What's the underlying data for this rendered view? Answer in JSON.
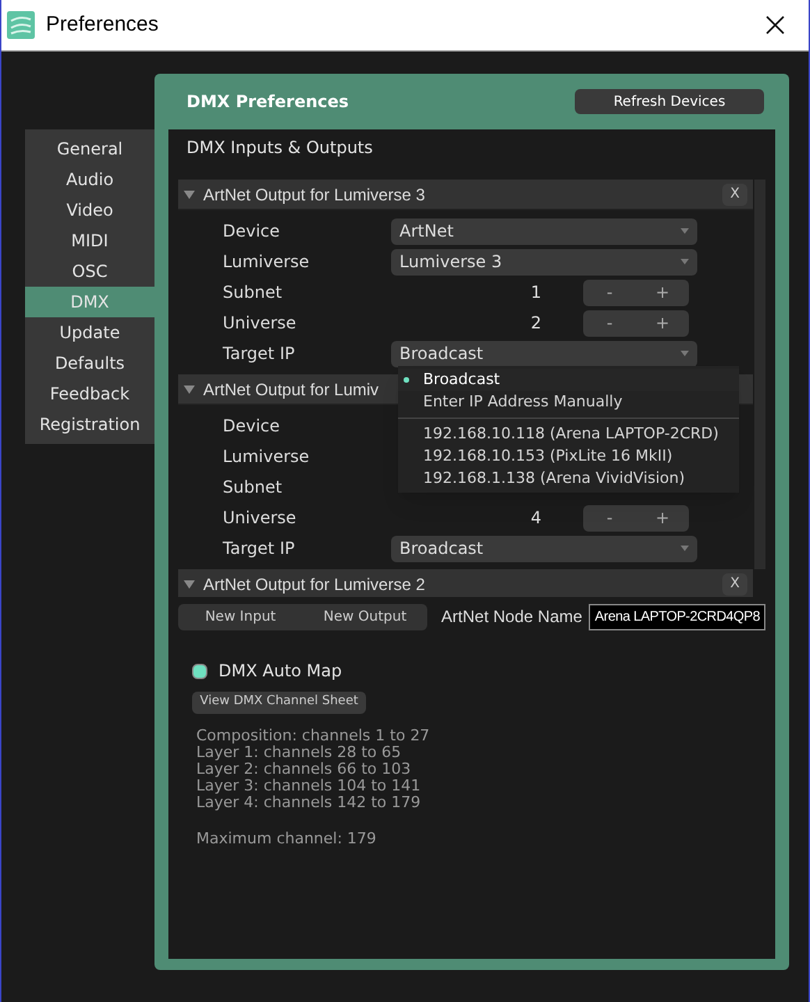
{
  "window": {
    "title": "Preferences"
  },
  "sidebar": {
    "items": [
      {
        "label": "General",
        "selected": false
      },
      {
        "label": "Audio",
        "selected": false
      },
      {
        "label": "Video",
        "selected": false
      },
      {
        "label": "MIDI",
        "selected": false
      },
      {
        "label": "OSC",
        "selected": false
      },
      {
        "label": "DMX",
        "selected": true
      },
      {
        "label": "Update",
        "selected": false
      },
      {
        "label": "Defaults",
        "selected": false
      },
      {
        "label": "Feedback",
        "selected": false
      },
      {
        "label": "Registration",
        "selected": false
      }
    ]
  },
  "panel": {
    "title": "DMX Preferences",
    "refresh_button": "Refresh Devices",
    "section_title": "DMX Inputs & Outputs"
  },
  "outputs": [
    {
      "title": "ArtNet Output for Lumiverse 3",
      "close": "X",
      "expanded": true,
      "rows": [
        {
          "kind": "select",
          "label": "Device",
          "value": "ArtNet"
        },
        {
          "kind": "select",
          "label": "Lumiverse",
          "value": "Lumiverse 3"
        },
        {
          "kind": "stepper",
          "label": "Subnet",
          "value": "1",
          "minus": "-",
          "plus": "+"
        },
        {
          "kind": "stepper",
          "label": "Universe",
          "value": "2",
          "minus": "-",
          "plus": "+"
        },
        {
          "kind": "select",
          "label": "Target IP",
          "value": "Broadcast"
        }
      ]
    },
    {
      "title": "ArtNet Output for Lumiv",
      "expanded": true,
      "rows": [
        {
          "kind": "hidden",
          "label": "Device"
        },
        {
          "kind": "hidden",
          "label": "Lumiverse"
        },
        {
          "kind": "hidden",
          "label": "Subnet"
        },
        {
          "kind": "stepper",
          "label": "Universe",
          "value": "4",
          "minus": "-",
          "plus": "+"
        },
        {
          "kind": "select",
          "label": "Target IP",
          "value": "Broadcast"
        }
      ]
    },
    {
      "title": "ArtNet Output for Lumiverse 2",
      "close": "X",
      "expanded": true
    }
  ],
  "dropdown": {
    "options": [
      {
        "label": "Broadcast",
        "selected": true
      },
      {
        "label": "Enter IP Address Manually",
        "selected": false
      }
    ],
    "devices": [
      {
        "label": "192.168.10.118 (Arena LAPTOP-2CRD)",
        "selected": false
      },
      {
        "label": "192.168.10.153 (PixLite 16 MkII)",
        "selected": false
      },
      {
        "label": "192.168.1.138 (Arena VividVision)",
        "selected": false
      }
    ]
  },
  "actions": {
    "new_input": "New Input",
    "new_output": "New Output",
    "node_name_label": "ArtNet Node Name",
    "node_name_value": "Arena LAPTOP-2CRD4QP8"
  },
  "auto_map": {
    "label": "DMX Auto Map",
    "checked": true,
    "sheet_button": "View DMX Channel Sheet"
  },
  "channel_info": [
    "Composition: channels 1 to 27",
    "Layer 1: channels 28 to 65",
    "Layer 2: channels 66 to 103",
    "Layer 3: channels 104 to 141",
    "Layer 4: channels 142 to 179"
  ],
  "maximum": "Maximum channel: 179"
}
